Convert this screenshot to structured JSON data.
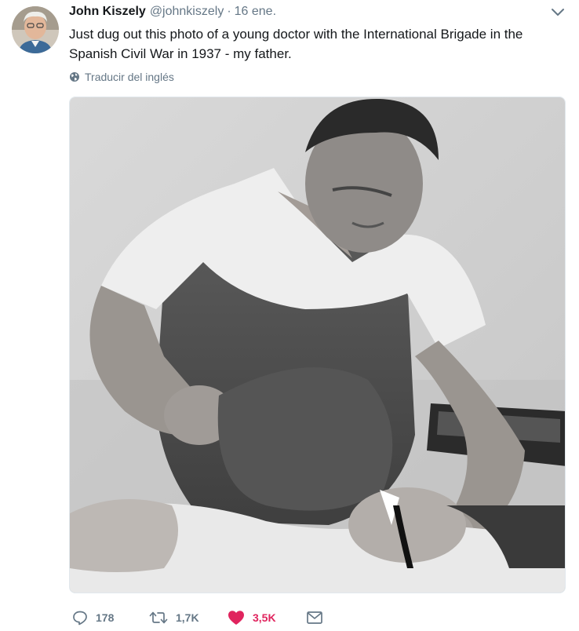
{
  "tweet": {
    "author": {
      "name": "John Kiszely",
      "handle": "@johnkiszely"
    },
    "separator": "·",
    "date": "16 ene.",
    "text": "Just dug out this photo of a young doctor with the International Brigade in the Spanish Civil War in 1937 - my father.",
    "translate_label": "Traducir del inglés",
    "actions": {
      "replies": "178",
      "retweets": "1,7K",
      "likes": "3,5K"
    },
    "like_color": "#e0245e",
    "muted_color": "#657786",
    "icons": {
      "reply": "reply-icon",
      "retweet": "retweet-icon",
      "like": "heart-icon",
      "message": "envelope-icon",
      "translate": "globe-icon",
      "menu": "chevron-down-icon"
    }
  }
}
